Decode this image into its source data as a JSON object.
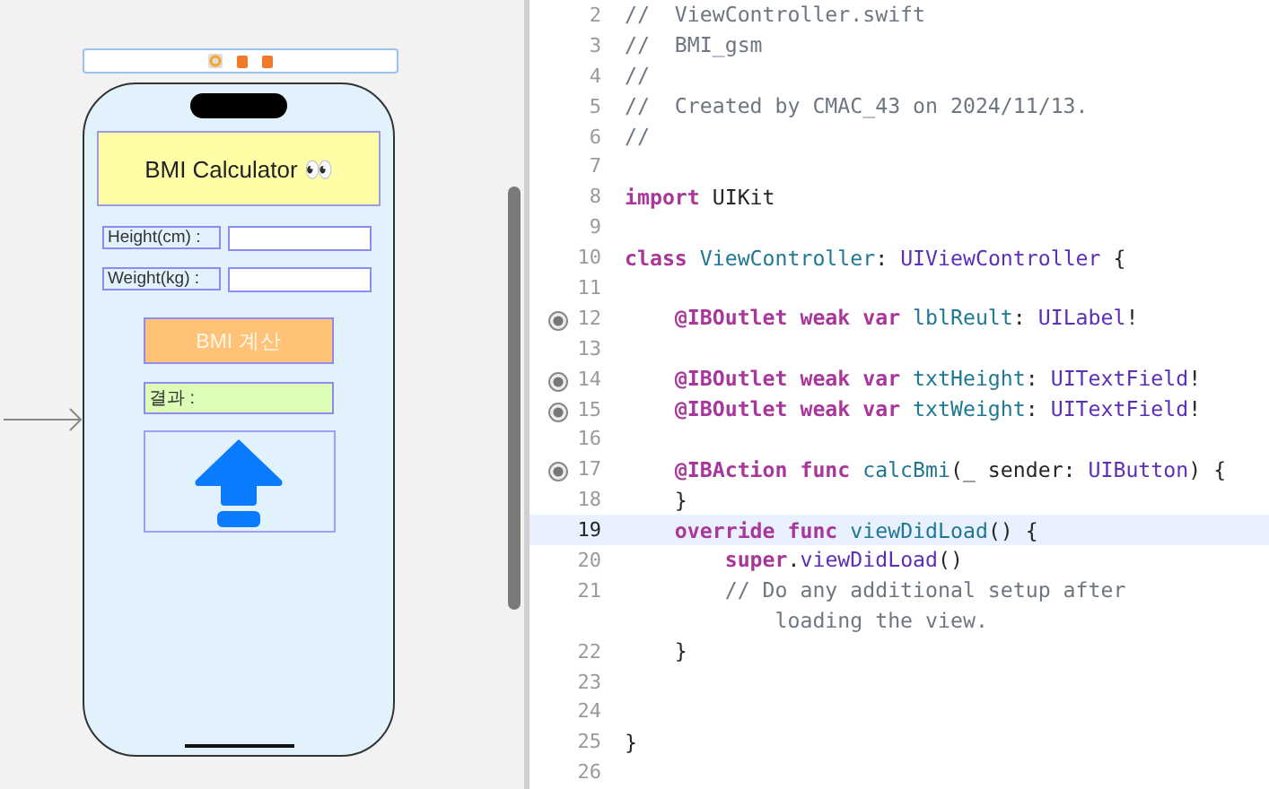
{
  "canvas": {
    "screen": {
      "title": "BMI Calculator 👀",
      "height_label": "Height(cm) :",
      "weight_label": "Weight(kg) :",
      "button": "BMI 계산",
      "result_label": "결과 :"
    }
  },
  "editor": {
    "lines": [
      {
        "number": "2",
        "tokens": [
          {
            "kind": "comment",
            "text": "//  ViewController.swift"
          }
        ]
      },
      {
        "number": "3",
        "tokens": [
          {
            "kind": "comment",
            "text": "//  BMI_gsm"
          }
        ]
      },
      {
        "number": "4",
        "tokens": [
          {
            "kind": "comment",
            "text": "//"
          }
        ]
      },
      {
        "number": "5",
        "tokens": [
          {
            "kind": "comment",
            "text": "//  Created by CMAC_43 on 2024/11/13."
          }
        ]
      },
      {
        "number": "6",
        "tokens": [
          {
            "kind": "comment",
            "text": "//"
          }
        ]
      },
      {
        "number": "7"
      },
      {
        "number": "8",
        "tokens": [
          {
            "kind": "keyword",
            "text": "import"
          },
          {
            "kind": "plain",
            "text": " UIKit"
          }
        ]
      },
      {
        "number": "9"
      },
      {
        "number": "10",
        "tokens": [
          {
            "kind": "keyword",
            "text": "class"
          },
          {
            "kind": "name",
            "text": " ViewController"
          },
          {
            "kind": "plain",
            "text": ": "
          },
          {
            "kind": "type",
            "text": "UIViewController"
          },
          {
            "kind": "plain",
            "text": " {"
          }
        ]
      },
      {
        "number": "11"
      },
      {
        "number": "12",
        "connected": true,
        "tokens": [
          {
            "kind": "keyword",
            "text": "    @IBOutlet weak var"
          },
          {
            "kind": "name",
            "text": " lblReult"
          },
          {
            "kind": "plain",
            "text": ": "
          },
          {
            "kind": "type",
            "text": "UILabel"
          },
          {
            "kind": "plain",
            "text": "!"
          }
        ]
      },
      {
        "number": "13"
      },
      {
        "number": "14",
        "connected": true,
        "tokens": [
          {
            "kind": "keyword",
            "text": "    @IBOutlet weak var"
          },
          {
            "kind": "name",
            "text": " txtHeight"
          },
          {
            "kind": "plain",
            "text": ": "
          },
          {
            "kind": "type",
            "text": "UITextField"
          },
          {
            "kind": "plain",
            "text": "!"
          }
        ]
      },
      {
        "number": "15",
        "connected": true,
        "tokens": [
          {
            "kind": "keyword",
            "text": "    @IBOutlet weak var"
          },
          {
            "kind": "name",
            "text": " txtWeight"
          },
          {
            "kind": "plain",
            "text": ": "
          },
          {
            "kind": "type",
            "text": "UITextField"
          },
          {
            "kind": "plain",
            "text": "!"
          }
        ]
      },
      {
        "number": "16"
      },
      {
        "number": "17",
        "connected": true,
        "tokens": [
          {
            "kind": "keyword",
            "text": "    @IBAction func"
          },
          {
            "kind": "name",
            "text": " calcBmi"
          },
          {
            "kind": "plain",
            "text": "(_ sender: "
          },
          {
            "kind": "type",
            "text": "UIButton"
          },
          {
            "kind": "plain",
            "text": ") {"
          }
        ]
      },
      {
        "number": "18",
        "tokens": [
          {
            "kind": "plain",
            "text": "    }"
          }
        ]
      },
      {
        "number": "19",
        "current": true,
        "tokens": [
          {
            "kind": "keyword",
            "text": "    override func"
          },
          {
            "kind": "name",
            "text": " viewDidLoad"
          },
          {
            "kind": "plain",
            "text": "() {"
          }
        ]
      },
      {
        "number": "20",
        "tokens": [
          {
            "kind": "keyword",
            "text": "        super"
          },
          {
            "kind": "plain",
            "text": "."
          },
          {
            "kind": "type",
            "text": "viewDidLoad"
          },
          {
            "kind": "plain",
            "text": "()"
          }
        ]
      },
      {
        "number": "21",
        "tokens": [
          {
            "kind": "comment",
            "text": "        // Do any additional setup after"
          }
        ]
      },
      {
        "tokens": [
          {
            "kind": "comment",
            "text": "            loading the view."
          }
        ]
      },
      {
        "number": "22",
        "tokens": [
          {
            "kind": "plain",
            "text": "    }"
          }
        ]
      },
      {
        "number": "23"
      },
      {
        "number": "24"
      },
      {
        "number": "25",
        "tokens": [
          {
            "kind": "plain",
            "text": "}"
          }
        ]
      },
      {
        "number": "26"
      }
    ]
  }
}
